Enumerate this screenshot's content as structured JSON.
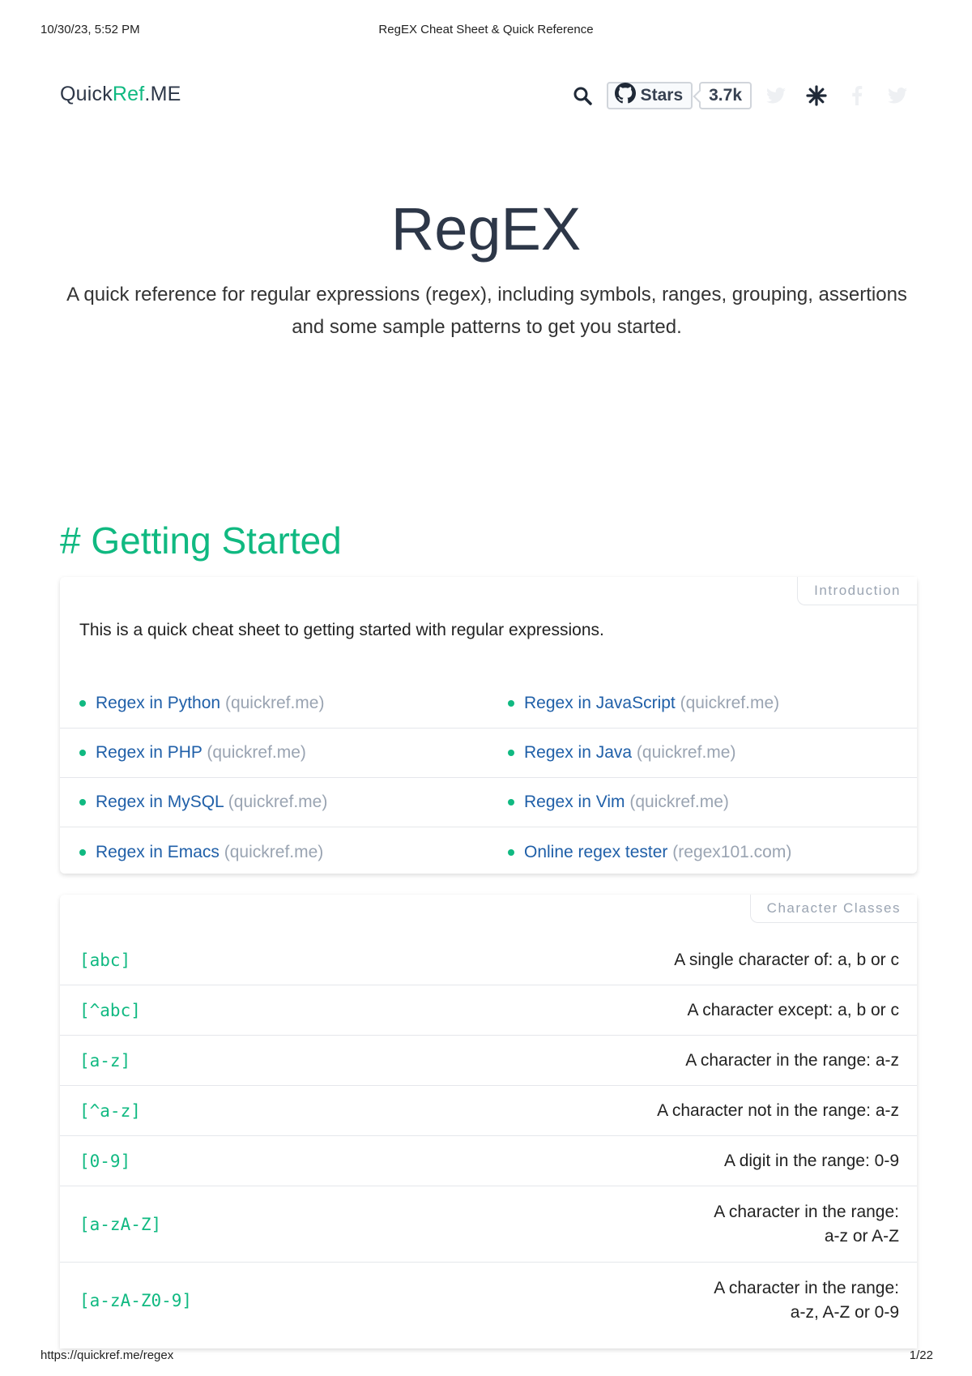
{
  "print_header": {
    "datetime": "10/30/23, 5:52 PM",
    "title": "RegEX Cheat Sheet & Quick Reference"
  },
  "print_footer": {
    "url": "https://quickref.me/regex",
    "page": "1/22"
  },
  "nav": {
    "logo_main": "Quick",
    "logo_accent": "Ref",
    "logo_suffix": ".ME",
    "github_label": "Stars",
    "github_count": "3.7k",
    "icons": [
      "search-icon",
      "github-icon",
      "twitter-icon",
      "theme-toggle-icon",
      "facebook-icon",
      "twitter-icon"
    ]
  },
  "hero": {
    "title": "RegEX",
    "description": "A quick reference for regular expressions (regex), including symbols, ranges, grouping, assertions and some sample patterns to get you started."
  },
  "section": {
    "title": "# Getting Started"
  },
  "intro_card": {
    "label": "Introduction",
    "text": "This is a quick cheat sheet to getting started with regular expressions.",
    "links": [
      {
        "text": "Regex in Python",
        "domain": "(quickref.me)"
      },
      {
        "text": "Regex in JavaScript",
        "domain": "(quickref.me)"
      },
      {
        "text": "Regex in PHP",
        "domain": "(quickref.me)"
      },
      {
        "text": "Regex in Java",
        "domain": "(quickref.me)"
      },
      {
        "text": "Regex in MySQL",
        "domain": "(quickref.me)"
      },
      {
        "text": "Regex in Vim",
        "domain": "(quickref.me)"
      },
      {
        "text": "Regex in Emacs",
        "domain": "(quickref.me)"
      },
      {
        "text": "Online regex tester",
        "domain": "(regex101.com)"
      }
    ]
  },
  "classes_card": {
    "label": "Character Classes",
    "rows": [
      {
        "code": "[abc]",
        "desc": "A single character of: a, b or c"
      },
      {
        "code": "[^abc]",
        "desc": "A character except: a, b or c"
      },
      {
        "code": "[a-z]",
        "desc": "A character in the range: a-z"
      },
      {
        "code": "[^a-z]",
        "desc": "A character not in the range: a-z"
      },
      {
        "code": "[0-9]",
        "desc": "A digit in the range: 0-9"
      },
      {
        "code": "[a-zA-Z]",
        "desc": "A character in the range:\na-z or A-Z"
      },
      {
        "code": "[a-zA-Z0-9]",
        "desc": "A character in the range:\na-z, A-Z or 0-9"
      }
    ]
  },
  "colors": {
    "accent": "#10b981",
    "link": "#1f5fa8",
    "muted": "#9aa4b2",
    "heading": "#2d3748"
  }
}
